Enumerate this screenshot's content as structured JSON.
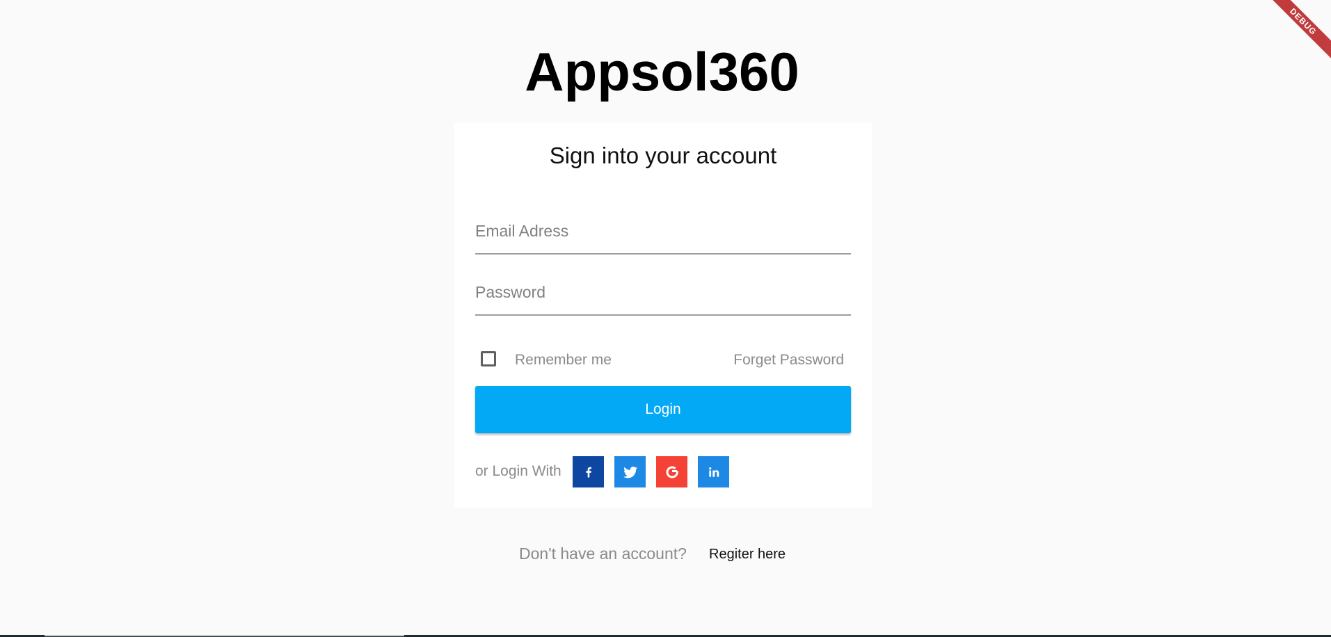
{
  "app": {
    "title": "Appsol360"
  },
  "login_card": {
    "heading": "Sign into your account",
    "email": {
      "placeholder": "Email Adress",
      "value": ""
    },
    "password": {
      "placeholder": "Password",
      "value": ""
    },
    "remember_label": "Remember me",
    "remember_checked": false,
    "forget_label": "Forget Password",
    "login_label": "Login",
    "alt_login_label": "or Login With",
    "social": [
      {
        "name": "facebook",
        "icon": "facebook-icon",
        "color": "#0d47a1"
      },
      {
        "name": "twitter",
        "icon": "twitter-icon",
        "color": "#1e88e5"
      },
      {
        "name": "google",
        "icon": "google-icon",
        "color": "#f44336"
      },
      {
        "name": "linkedin",
        "icon": "linkedin-icon",
        "color": "#1e88e5"
      }
    ]
  },
  "footer": {
    "question": "Don't have an account?",
    "register_label": "Regiter here"
  },
  "debug_banner": "DEBUG",
  "colors": {
    "primary": "#03a9f4",
    "background": "#fafafa",
    "card": "#ffffff",
    "muted_text": "#8a8a8a"
  }
}
